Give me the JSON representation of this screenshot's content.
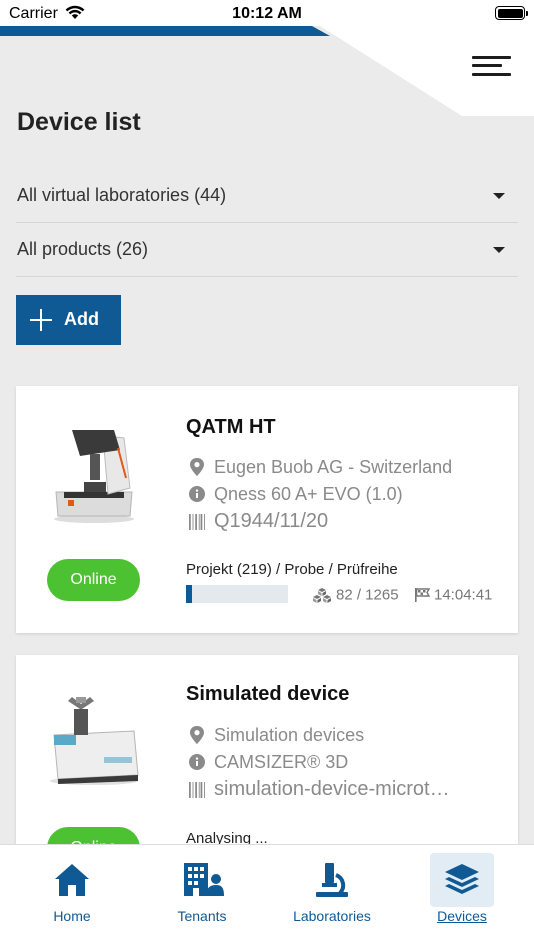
{
  "status_bar": {
    "carrier": "Carrier",
    "time": "10:12 AM"
  },
  "colors": {
    "accent": "#0f5a94",
    "online": "#4cc132",
    "background": "#ebebeb"
  },
  "page": {
    "title": "Device list"
  },
  "filters": {
    "laboratories": "All virtual laboratories (44)",
    "products": "All products (26)"
  },
  "add_button": {
    "label": "Add"
  },
  "devices": [
    {
      "name": "QATM HT",
      "location": "Eugen Buob AG - Switzerland",
      "model": "Qness 60 A+ EVO (1.0)",
      "serial": "Q1944/11/20",
      "status": "Online",
      "job": "Projekt (219) / Probe / Prüfreihe",
      "progress": 0.06,
      "count": "82 / 1265",
      "time": "14:04:41"
    },
    {
      "name": "Simulated device",
      "location": "Simulation devices",
      "model": "CAMSIZER® 3D",
      "serial": "simulation-device-microt…",
      "status": "Online",
      "job": "Analysing ..."
    }
  ],
  "tabs": [
    {
      "label": "Home",
      "icon": "home-icon"
    },
    {
      "label": "Tenants",
      "icon": "building-users-icon"
    },
    {
      "label": "Laboratories",
      "icon": "microscope-icon"
    },
    {
      "label": "Devices",
      "icon": "layers-icon",
      "active": true
    }
  ]
}
